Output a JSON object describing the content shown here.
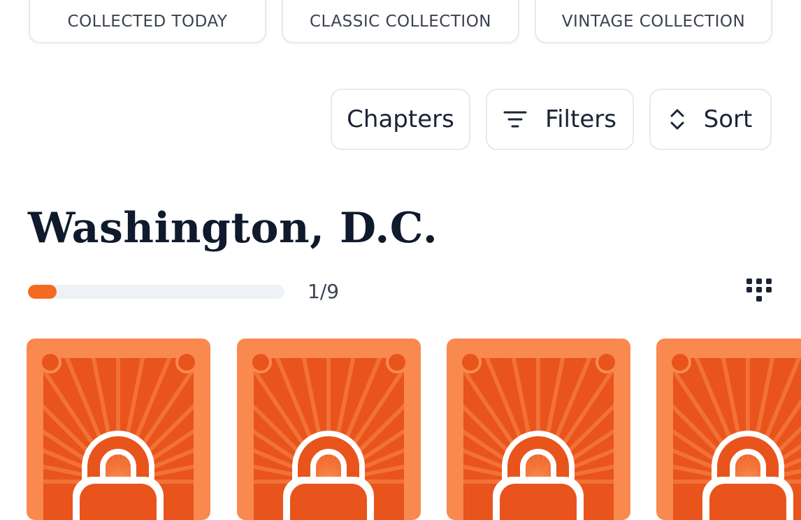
{
  "tabs": [
    {
      "label": "COLLECTED TODAY"
    },
    {
      "label": "CLASSIC COLLECTION"
    },
    {
      "label": "VINTAGE COLLECTION"
    }
  ],
  "controls": {
    "chapters_label": "Chapters",
    "filters_label": "Filters",
    "sort_label": "Sort"
  },
  "section": {
    "title": "Washington, D.C.",
    "progress_text": "1/9",
    "progress_fraction": 0.111
  },
  "icons": [
    "filter-icon",
    "sort-icon",
    "grid-view-icon",
    "lock-icon"
  ],
  "colors": {
    "accent": "#f66b22",
    "card_bg": "#f9894f",
    "card_inner": "#e8541b",
    "title": "#0f1a2c"
  },
  "cards": [
    {
      "state": "locked"
    },
    {
      "state": "locked"
    },
    {
      "state": "locked"
    },
    {
      "state": "locked"
    }
  ]
}
